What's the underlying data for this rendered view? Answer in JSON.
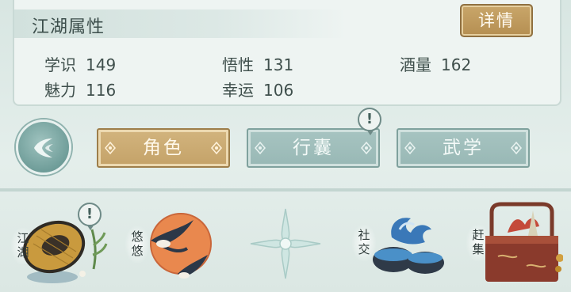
{
  "attributes": {
    "title": "江湖属性",
    "detail_label": "详情",
    "stats": [
      {
        "label": "学识",
        "value": "149"
      },
      {
        "label": "悟性",
        "value": "131"
      },
      {
        "label": "酒量",
        "value": "162"
      },
      {
        "label": "魅力",
        "value": "116"
      },
      {
        "label": "幸运",
        "value": "106"
      }
    ]
  },
  "tabs": [
    {
      "label": "角色",
      "active": true
    },
    {
      "label": "行囊",
      "active": false,
      "alert": "!"
    },
    {
      "label": "武学",
      "active": false
    }
  ],
  "bottom_nav": [
    {
      "label": "江湖",
      "icon": "bamboo-hat-icon",
      "alert": "!"
    },
    {
      "label": "悠悠",
      "icon": "swallows-sun-icon"
    },
    {
      "label": "",
      "icon": "compass-star-icon"
    },
    {
      "label": "社交",
      "icon": "wave-bowls-icon"
    },
    {
      "label": "赶集",
      "icon": "market-basket-icon"
    }
  ],
  "colors": {
    "active_tab": "#c4a268",
    "inactive_tab": "#98b8b5",
    "background": "#dfeae7"
  }
}
